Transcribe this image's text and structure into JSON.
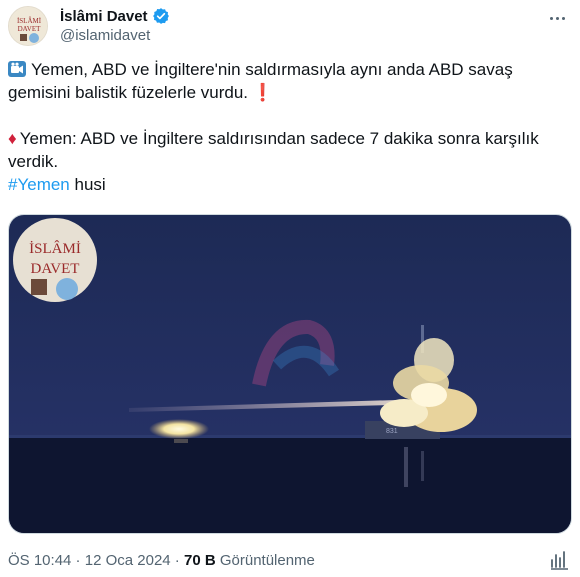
{
  "account": {
    "display_name": "İslâmi Davet",
    "handle": "@islamidavet",
    "avatar_logo_text": [
      "İSLÂMİ",
      "DAVET"
    ]
  },
  "tweet": {
    "para1_text": "Yemen, ABD ve İngiltere'nin saldırmasıyla aynı anda ABD savaş gemisini balistik füzelerle vurdu.",
    "para2_text": "Yemen: ABD ve İngiltere saldırısından sadece 7 dakika sonra karşılık verdik.",
    "hashtag": "#Yemen",
    "trailing_word": "husi"
  },
  "media": {
    "watermark_text": [
      "İSLÂMİ",
      "DAVET"
    ],
    "hull_number": "831"
  },
  "footer": {
    "time": "ÖS 10:44",
    "separator": " · ",
    "date": "12 Oca 2024",
    "views_count": "70 B",
    "views_label": "Görüntülenme"
  },
  "icons": [
    "verified-badge-icon",
    "more-options-icon",
    "movie-camera-icon",
    "exclamation-icon",
    "red-diamond-icon",
    "analytics-icon"
  ],
  "colors": {
    "link": "#1d9bf0",
    "secondary": "#536471",
    "verified": "#1d9bf0"
  }
}
